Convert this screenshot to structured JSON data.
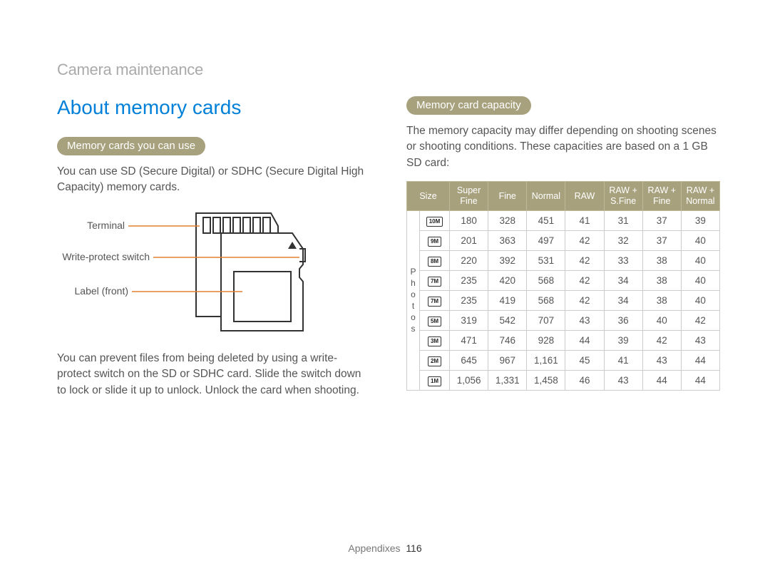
{
  "section": "Camera maintenance",
  "title": "About memory cards",
  "left": {
    "pill": "Memory cards you can use",
    "p1": "You can use SD (Secure Digital) or SDHC (Secure Digital High Capacity) memory cards.",
    "labels": {
      "terminal": "Terminal",
      "wps": "Write-protect switch",
      "label": "Label (front)"
    },
    "p2": "You can prevent files from being deleted by using a write-protect switch on the SD or SDHC card. Slide the switch down to lock or slide it up to unlock. Unlock the card when shooting."
  },
  "right": {
    "pill": "Memory card capacity",
    "p1": "The memory capacity may differ depending on shooting scenes or shooting conditions. These capacities are based on a 1 GB SD card:",
    "rowgroup_label": "Photos"
  },
  "chart_data": {
    "type": "table",
    "columns": [
      "Size",
      "Super Fine",
      "Fine",
      "Normal",
      "RAW",
      "RAW + S.Fine",
      "RAW + Fine",
      "RAW + Normal"
    ],
    "size_labels": [
      "10M",
      "9M",
      "8M",
      "7M",
      "7M",
      "5M",
      "3M",
      "2M",
      "1M"
    ],
    "rows": [
      [
        "180",
        "328",
        "451",
        "41",
        "31",
        "37",
        "39"
      ],
      [
        "201",
        "363",
        "497",
        "42",
        "32",
        "37",
        "40"
      ],
      [
        "220",
        "392",
        "531",
        "42",
        "33",
        "38",
        "40"
      ],
      [
        "235",
        "420",
        "568",
        "42",
        "34",
        "38",
        "40"
      ],
      [
        "235",
        "419",
        "568",
        "42",
        "34",
        "38",
        "40"
      ],
      [
        "319",
        "542",
        "707",
        "43",
        "36",
        "40",
        "42"
      ],
      [
        "471",
        "746",
        "928",
        "44",
        "39",
        "42",
        "43"
      ],
      [
        "645",
        "967",
        "1,161",
        "45",
        "41",
        "43",
        "44"
      ],
      [
        "1,056",
        "1,331",
        "1,458",
        "46",
        "43",
        "44",
        "44"
      ]
    ]
  },
  "footer": {
    "label": "Appendixes",
    "page": "116"
  }
}
